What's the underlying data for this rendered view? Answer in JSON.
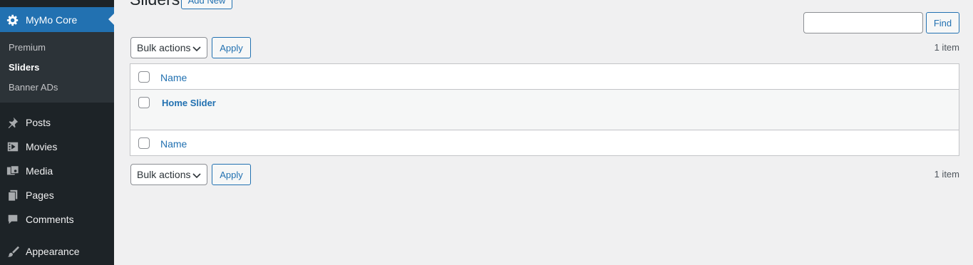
{
  "sidebar": {
    "current_menu": {
      "label": "MyMo Core",
      "icon": "gear-icon"
    },
    "submenu": [
      {
        "label": "Premium",
        "current": false
      },
      {
        "label": "Sliders",
        "current": true
      },
      {
        "label": "Banner ADs",
        "current": false
      }
    ],
    "items": [
      {
        "label": "Posts",
        "icon": "pushpin-icon"
      },
      {
        "label": "Movies",
        "icon": "video-icon"
      },
      {
        "label": "Media",
        "icon": "media-icon"
      },
      {
        "label": "Pages",
        "icon": "pages-icon"
      },
      {
        "label": "Comments",
        "icon": "comment-icon"
      },
      {
        "label": "Appearance",
        "icon": "paintbrush-icon"
      }
    ]
  },
  "header": {
    "title": "Sliders",
    "add_new_label": "Add New"
  },
  "search": {
    "value": "",
    "button_label": "Find"
  },
  "top_actions": {
    "bulk_label": "Bulk actions",
    "apply_label": "Apply",
    "count": "1 item"
  },
  "table": {
    "header_label": "Name",
    "footer_label": "Name",
    "rows": [
      {
        "name": "Home Slider"
      }
    ]
  },
  "bottom_actions": {
    "bulk_label": "Bulk actions",
    "apply_label": "Apply",
    "count": "1 item"
  },
  "colors": {
    "sidebar_bg": "#1d2327",
    "submenu_bg": "#2c3338",
    "accent": "#2271b1",
    "page_bg": "#f0f0f1"
  }
}
